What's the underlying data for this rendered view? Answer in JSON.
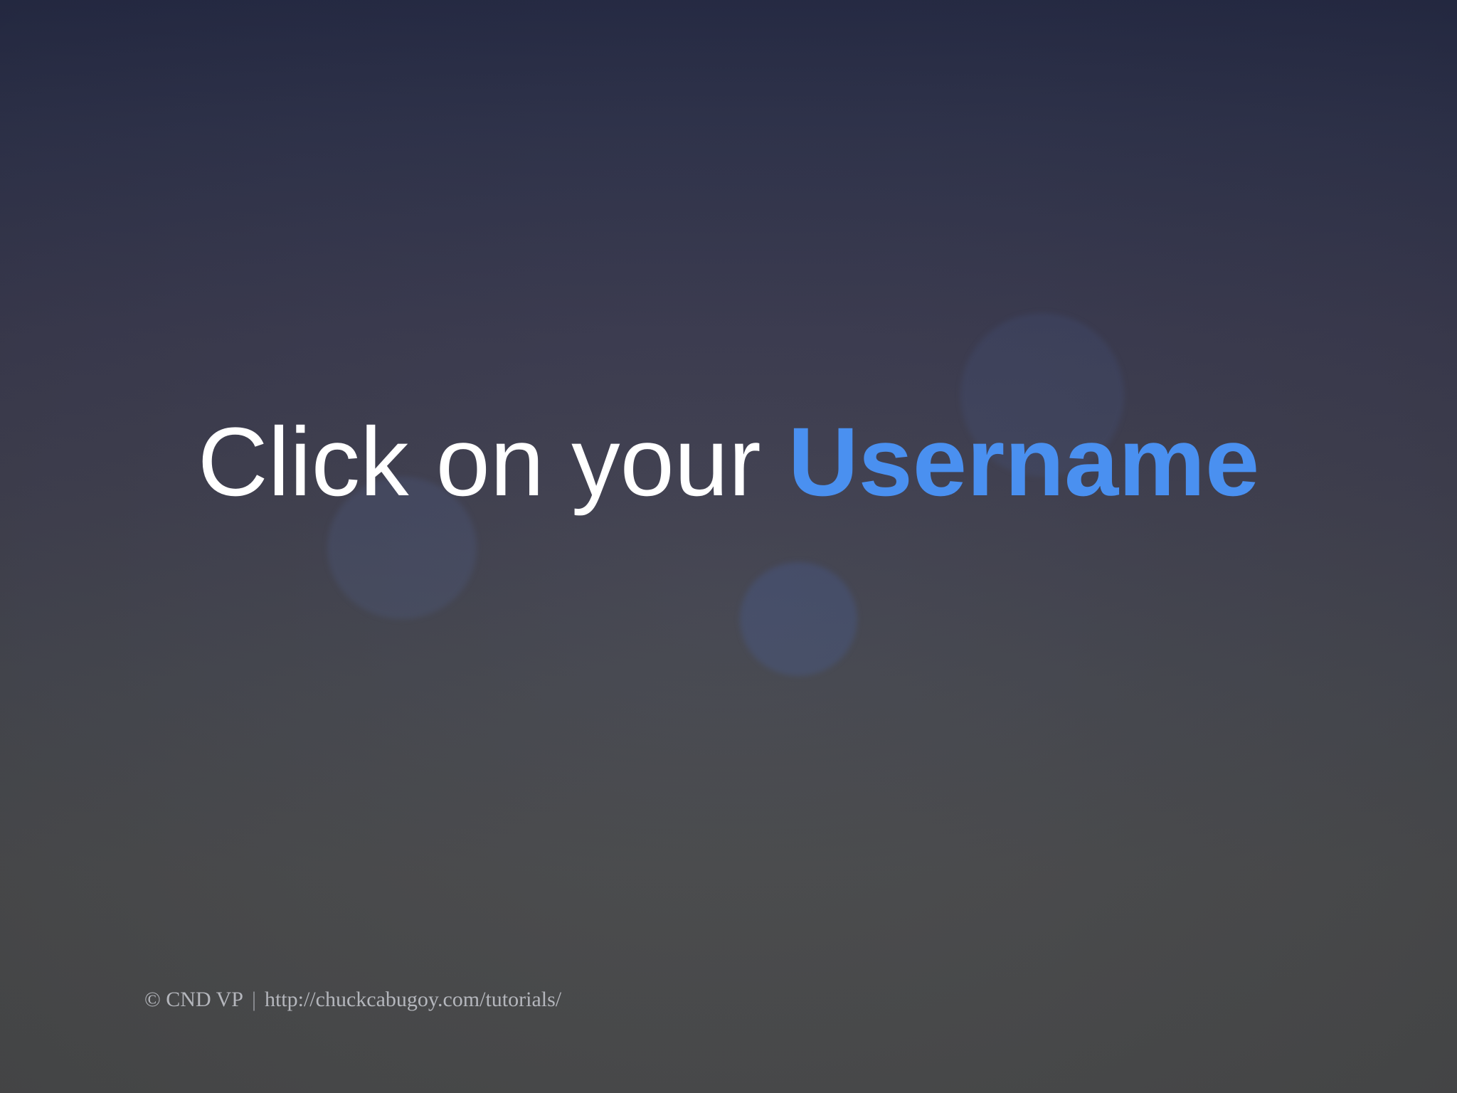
{
  "slide": {
    "headline_main": "Click on your ",
    "headline_highlight": "Username",
    "highlight_color": "#4a90f0"
  },
  "footer": {
    "copyright": "© CND VP",
    "separator": "|",
    "url": "http://chuckcabugoy.com/tutorials/"
  }
}
